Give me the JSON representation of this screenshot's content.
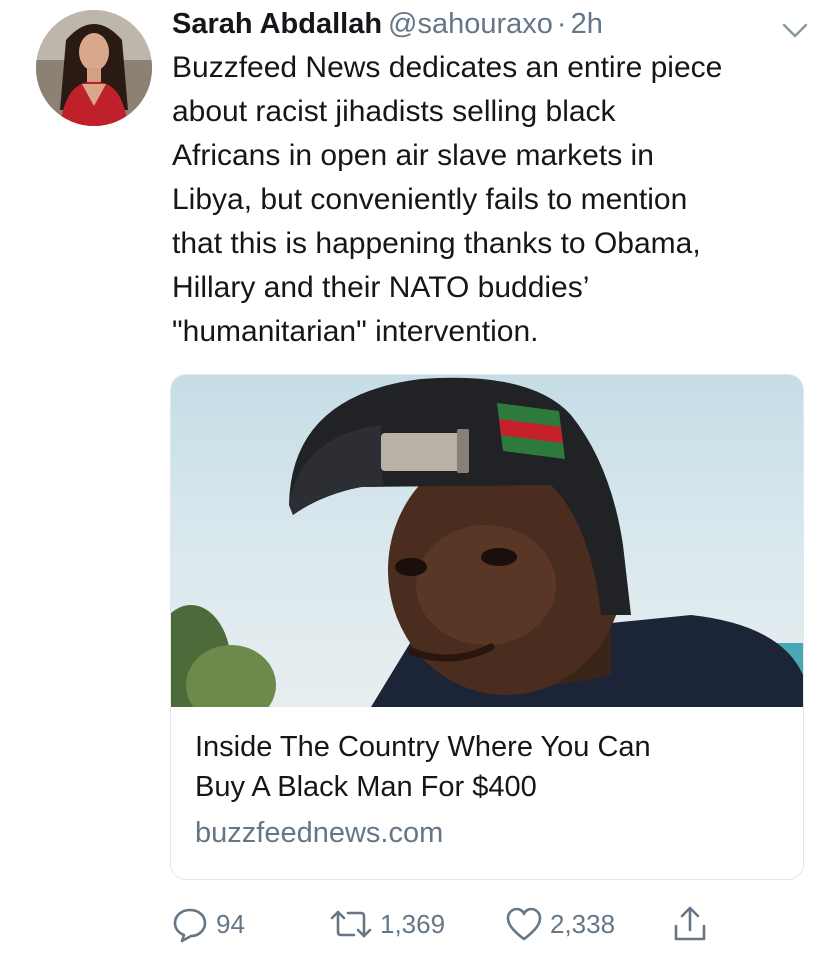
{
  "tweet": {
    "author_name": "Sarah Abdallah",
    "author_handle": "@sahouraxo",
    "separator": "·",
    "time": "2h",
    "text_lines": [
      "Buzzfeed News dedicates an entire piece",
      "about racist jihadists selling black",
      "Africans in open air slave markets in",
      "Libya, but conveniently fails to mention",
      "that this is happening thanks to Obama,",
      "Hillary and their NATO buddies’",
      "\"humanitarian\" intervention."
    ]
  },
  "card": {
    "title_lines": [
      "Inside The Country Where You Can",
      "Buy A Black Man For $400"
    ],
    "domain": "buzzfeednews.com"
  },
  "actions": {
    "replies": "94",
    "retweets": "1,369",
    "likes": "2,338"
  },
  "icons": {
    "reply": "reply-icon",
    "retweet": "retweet-icon",
    "like": "heart-icon",
    "share": "share-icon",
    "menu": "chevron-down-icon"
  },
  "colors": {
    "text": "#14171a",
    "secondary": "#657786",
    "border": "#e1e8ed"
  }
}
